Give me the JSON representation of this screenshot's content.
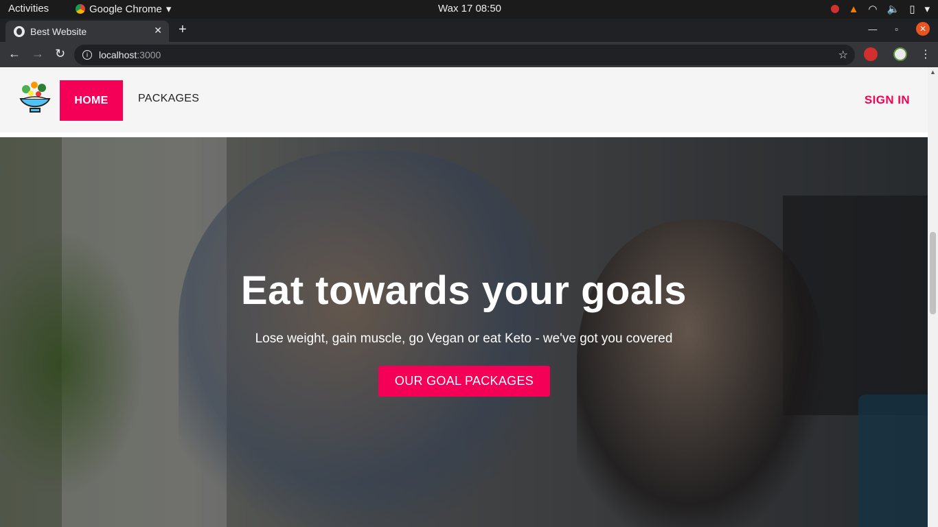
{
  "topbar": {
    "activities": "Activities",
    "app_name": "Google Chrome",
    "clock": "Wax 17  08:50"
  },
  "browser": {
    "tab_title": "Best Website",
    "url_host": "localhost",
    "url_port": ":3000"
  },
  "nav": {
    "home": "HOME",
    "packages": "PACKAGES",
    "sign_in": "SIGN IN"
  },
  "hero": {
    "title": "Eat towards your goals",
    "subtitle": "Lose weight, gain muscle, go Vegan or eat Keto - we've got you covered",
    "cta": "OUR GOAL PACKAGES"
  },
  "colors": {
    "accent": "#f50057",
    "navbar_bg": "#f5f5f5",
    "chrome_dark": "#202124"
  },
  "icons": [
    "chrome-icon",
    "globe-icon",
    "close-icon",
    "plus-icon",
    "back-icon",
    "forward-icon",
    "reload-icon",
    "info-icon",
    "star-icon",
    "menu-icon",
    "wifi-icon",
    "volume-icon",
    "battery-icon",
    "salad-bowl-logo"
  ]
}
